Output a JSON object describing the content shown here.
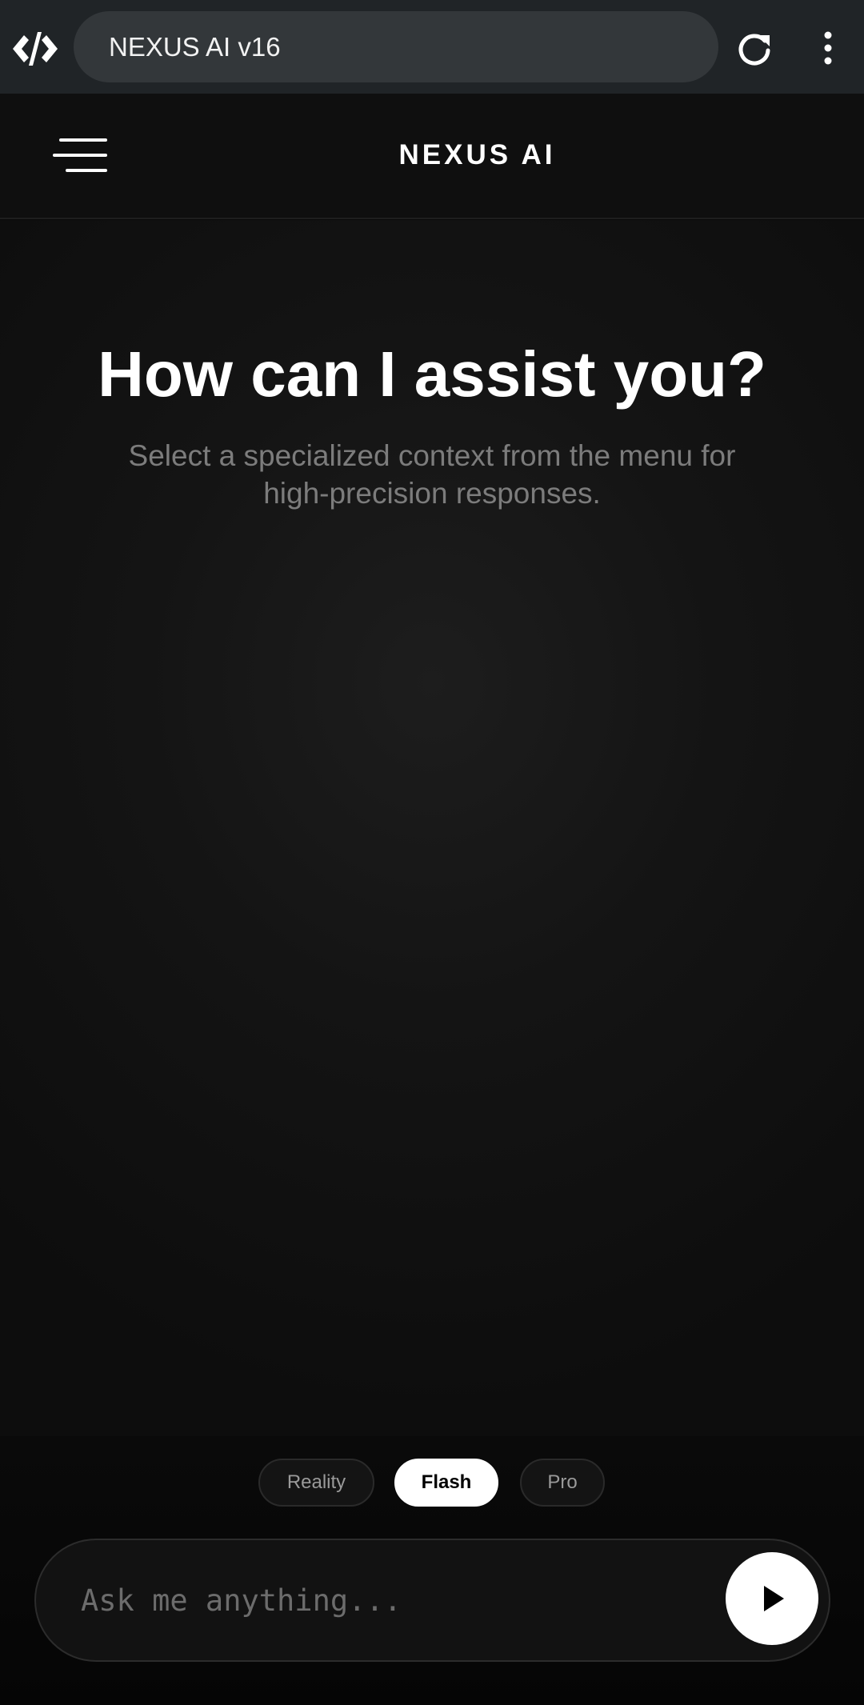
{
  "browser": {
    "tab_title": "NEXUS AI v16",
    "logo_icon": "code-brackets-logo-icon",
    "reload_icon": "reload-icon",
    "more_icon": "more-vertical-icon"
  },
  "header": {
    "title": "NEXUS AI",
    "menu_icon": "menu-icon"
  },
  "hero": {
    "title": "How can I assist you?",
    "subtitle_line1": "Select a specialized context from the menu for",
    "subtitle_line2": "high-precision responses."
  },
  "modes": {
    "items": [
      "Reality",
      "Flash",
      "Pro"
    ],
    "selected": "Flash"
  },
  "composer": {
    "placeholder": "Ask me anything...",
    "value": "",
    "send_icon": "send-play-icon"
  },
  "colors": {
    "browser_bar": "#202427",
    "background": "#0a0a0a",
    "accent": "#ffffff",
    "muted_text": "#7c7c7c"
  }
}
